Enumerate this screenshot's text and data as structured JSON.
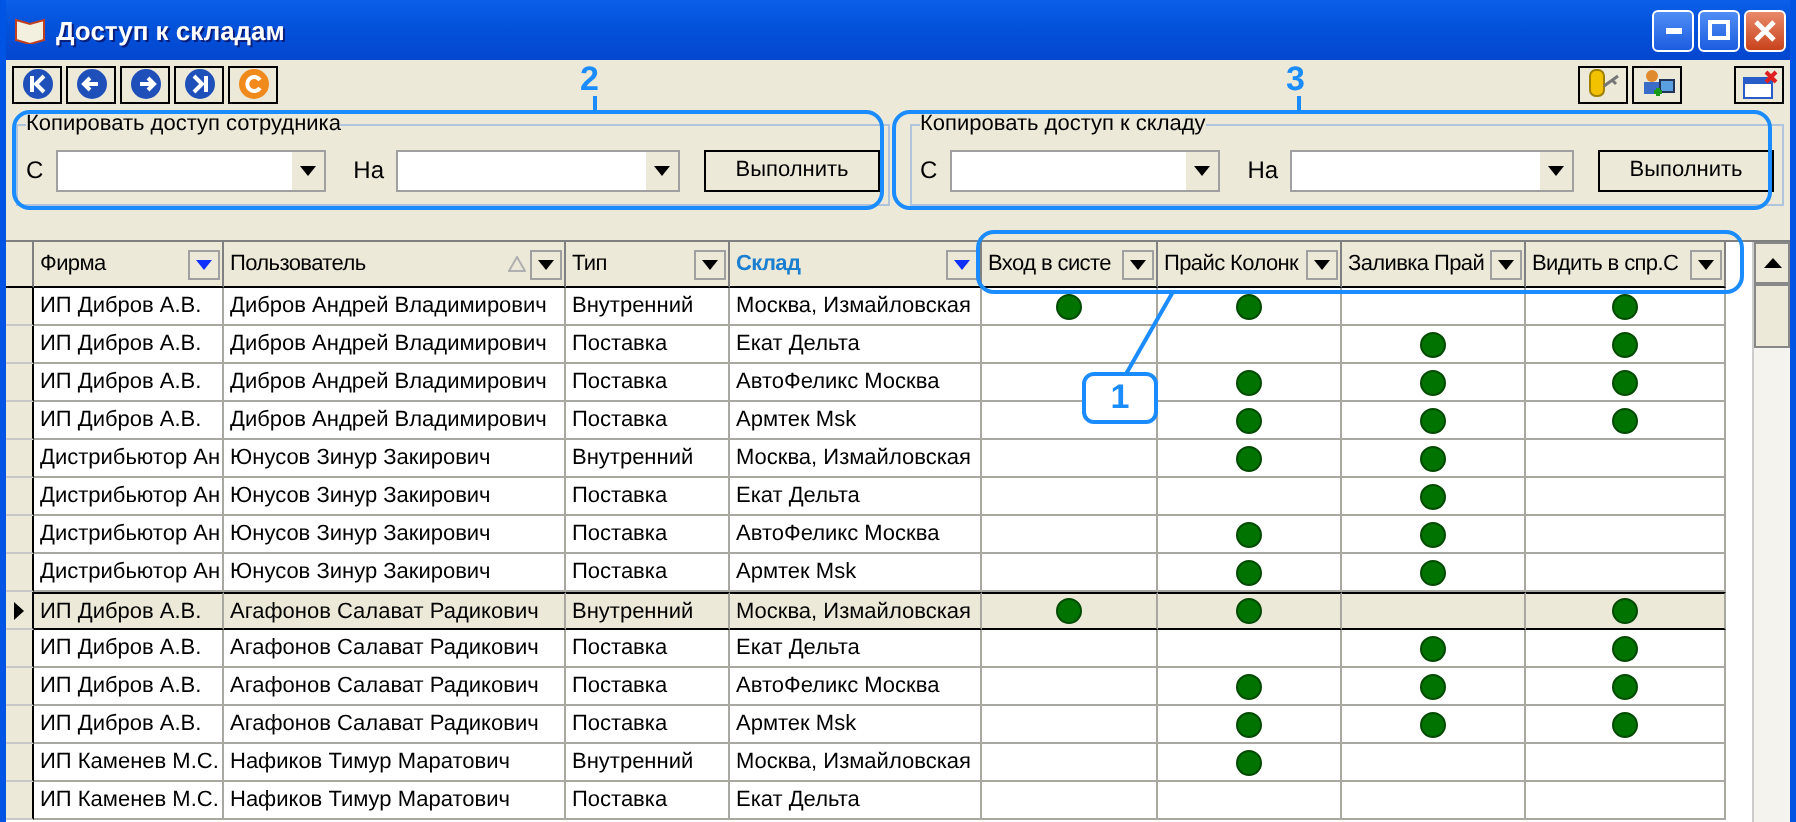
{
  "window": {
    "title": "Доступ к складам"
  },
  "copy_panels": [
    {
      "legend": "Копировать доступ сотрудника",
      "from_label": "С",
      "to_label": "На",
      "button": "Выполнить"
    },
    {
      "legend": "Копировать доступ к складу",
      "from_label": "С",
      "to_label": "На",
      "button": "Выполнить"
    }
  ],
  "table": {
    "columns": [
      {
        "label": "Фирма",
        "filtered": true,
        "sorted": false,
        "highlighted": false
      },
      {
        "label": "Пользователь",
        "filtered": false,
        "sorted": true,
        "highlighted": false
      },
      {
        "label": "Тип",
        "filtered": false,
        "sorted": false,
        "highlighted": false
      },
      {
        "label": "Склад",
        "filtered": true,
        "sorted": false,
        "highlighted": true
      },
      {
        "label": "Вход в систе",
        "filtered": false,
        "sorted": false,
        "highlighted": false
      },
      {
        "label": "Прайс Колонк",
        "filtered": false,
        "sorted": false,
        "highlighted": false
      },
      {
        "label": "Заливка Прай",
        "filtered": false,
        "sorted": false,
        "highlighted": false
      },
      {
        "label": "Видить в спр.С",
        "filtered": false,
        "sorted": false,
        "highlighted": false
      }
    ],
    "rows": [
      {
        "cells": [
          "ИП Дибров А.В.",
          "Дибров Андрей Владимирович",
          "Внутренний",
          "Москва, Измайловская"
        ],
        "flags": [
          true,
          true,
          false,
          true
        ],
        "selected": false
      },
      {
        "cells": [
          "ИП Дибров А.В.",
          "Дибров Андрей Владимирович",
          "Поставка",
          "Екат Дельта"
        ],
        "flags": [
          false,
          false,
          true,
          true
        ],
        "selected": false
      },
      {
        "cells": [
          "ИП Дибров А.В.",
          "Дибров Андрей Владимирович",
          "Поставка",
          "АвтоФеликс Москва"
        ],
        "flags": [
          false,
          true,
          true,
          true
        ],
        "selected": false
      },
      {
        "cells": [
          "ИП Дибров А.В.",
          "Дибров Андрей Владимирович",
          "Поставка",
          "Армтек Msk"
        ],
        "flags": [
          false,
          true,
          true,
          true
        ],
        "selected": false
      },
      {
        "cells": [
          "Дистрибьютор Ан",
          "Юнусов Зинур Закирович",
          "Внутренний",
          "Москва, Измайловская"
        ],
        "flags": [
          false,
          true,
          true,
          false
        ],
        "selected": false
      },
      {
        "cells": [
          "Дистрибьютор Ан",
          "Юнусов Зинур Закирович",
          "Поставка",
          "Екат Дельта"
        ],
        "flags": [
          false,
          false,
          true,
          false
        ],
        "selected": false
      },
      {
        "cells": [
          "Дистрибьютор Ан",
          "Юнусов Зинур Закирович",
          "Поставка",
          "АвтоФеликс Москва"
        ],
        "flags": [
          false,
          true,
          true,
          false
        ],
        "selected": false
      },
      {
        "cells": [
          "Дистрибьютор Ан",
          "Юнусов Зинур Закирович",
          "Поставка",
          "Армтек Msk"
        ],
        "flags": [
          false,
          true,
          true,
          false
        ],
        "selected": false
      },
      {
        "cells": [
          "ИП Дибров А.В.",
          "Агафонов Салават Радикович",
          "Внутренний",
          "Москва, Измайловская"
        ],
        "flags": [
          true,
          true,
          false,
          true
        ],
        "selected": true
      },
      {
        "cells": [
          "ИП Дибров А.В.",
          "Агафонов Салават Радикович",
          "Поставка",
          "Екат Дельта"
        ],
        "flags": [
          false,
          false,
          true,
          true
        ],
        "selected": false
      },
      {
        "cells": [
          "ИП Дибров А.В.",
          "Агафонов Салават Радикович",
          "Поставка",
          "АвтоФеликс Москва"
        ],
        "flags": [
          false,
          true,
          true,
          true
        ],
        "selected": false
      },
      {
        "cells": [
          "ИП Дибров А.В.",
          "Агафонов Салават Радикович",
          "Поставка",
          "Армтек Msk"
        ],
        "flags": [
          false,
          true,
          true,
          true
        ],
        "selected": false
      },
      {
        "cells": [
          "ИП Каменев М.С.",
          "Нафиков Тимур Маратович",
          "Внутренний",
          "Москва, Измайловская"
        ],
        "flags": [
          false,
          true,
          false,
          false
        ],
        "selected": false
      },
      {
        "cells": [
          "ИП Каменев М.С.",
          "Нафиков Тимур Маратович",
          "Поставка",
          "Екат Дельта"
        ],
        "flags": [
          false,
          false,
          false,
          false
        ],
        "selected": false
      }
    ]
  },
  "annotations": [
    {
      "label": "2",
      "kind": "panel1"
    },
    {
      "label": "3",
      "kind": "panel2"
    },
    {
      "label": "1",
      "kind": "headers"
    }
  ]
}
